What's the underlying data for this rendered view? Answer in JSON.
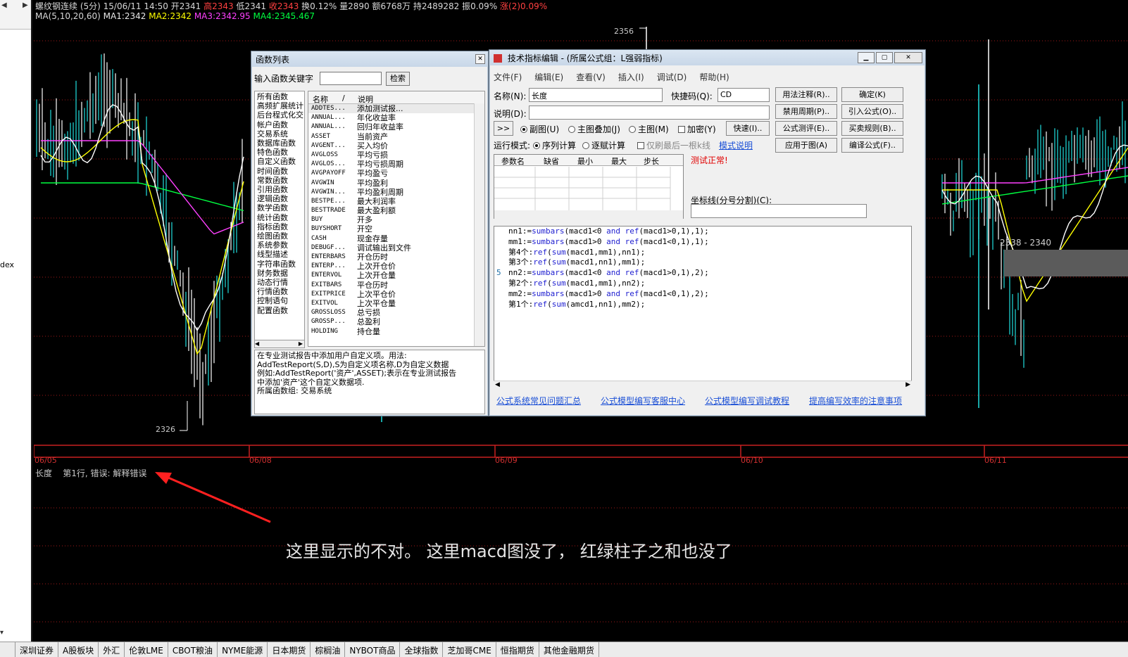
{
  "chart_header": {
    "line1": [
      {
        "text": "螺纹钢连续 (5分) 15/06/11 14:50",
        "color": "#d8d8d8"
      },
      {
        "text": "开2341",
        "color": "#d8d8d8"
      },
      {
        "text": "高2343",
        "color": "#ff4040"
      },
      {
        "text": "低2341",
        "color": "#d8d8d8"
      },
      {
        "text": "收2343",
        "color": "#ff4040"
      },
      {
        "text": "换0.12%",
        "color": "#d8d8d8"
      },
      {
        "text": "量2890",
        "color": "#d8d8d8"
      },
      {
        "text": "额6768万",
        "color": "#d8d8d8"
      },
      {
        "text": "持2489282",
        "color": "#d8d8d8"
      },
      {
        "text": "振0.09%",
        "color": "#d8d8d8"
      },
      {
        "text": "涨(2)0.09%",
        "color": "#ff4040"
      }
    ],
    "line2": [
      {
        "text": "MA(5,10,20,60)",
        "color": "#d8d8d8"
      },
      {
        "text": "MA1:2342",
        "color": "#e8e8e8"
      },
      {
        "text": "MA2:2342",
        "color": "#ffff00"
      },
      {
        "text": "MA3:2342.95",
        "color": "#ff40ff"
      },
      {
        "text": "MA4:2345.467",
        "color": "#00ff40"
      }
    ]
  },
  "price_labels": {
    "top_price": "2356",
    "bottom_price": "2326",
    "band": "2338 - 2340"
  },
  "dates": [
    "06/05",
    "06/08",
    "06/09",
    "06/10",
    "06/11"
  ],
  "sub_panel": {
    "indicator": "长度",
    "error": "第1行, 错误: 解释错误"
  },
  "annotation_text": "这里显示的不对。 这里macd图没了， 红绿柱子之和也没了",
  "left_panel": {
    "text": "dex"
  },
  "tabs": [
    "深圳证券",
    "A股板块",
    "外汇",
    "伦敦LME",
    "CBOT粮油",
    "NYME能源",
    "日本期货",
    "棕榈油",
    "NYBOT商品",
    "全球指数",
    "芝加哥CME",
    "恒指期货",
    "其他金融期货"
  ],
  "function_window": {
    "title": "函数列表",
    "search_label": "输入函数关键字",
    "search_value": "",
    "search_button": "检索",
    "categories": [
      "所有函数",
      "高频扩展统计",
      "后台程式化交",
      "帐户函数",
      "交易系统",
      "数据库函数",
      "特色函数",
      "自定义函数",
      "时间函数",
      "常数函数",
      "引用函数",
      "逻辑函数",
      "数学函数",
      "统计函数",
      "指标函数",
      "绘图函数",
      "系统参数",
      "线型描述",
      "字符串函数",
      "财务数据",
      "动态行情",
      "行情函数",
      "控制语句",
      "配置函数"
    ],
    "columns": [
      "名称",
      "/",
      "说明"
    ],
    "functions": [
      {
        "name": "ADDTES...",
        "desc": "添加测试报..."
      },
      {
        "name": "ANNUAL...",
        "desc": "年化收益率"
      },
      {
        "name": "ANNUAL...",
        "desc": "回归年收益率"
      },
      {
        "name": "ASSET",
        "desc": "当前资产"
      },
      {
        "name": "AVGENT...",
        "desc": "买入均价"
      },
      {
        "name": "AVGLOSS",
        "desc": "平均亏损"
      },
      {
        "name": "AVGLOS...",
        "desc": "平均亏损周期"
      },
      {
        "name": "AVGPAYOFF",
        "desc": "平均盈亏"
      },
      {
        "name": "AVGWIN",
        "desc": "平均盈利"
      },
      {
        "name": "AVGWIN...",
        "desc": "平均盈利周期"
      },
      {
        "name": "BESTPE...",
        "desc": "最大利润率"
      },
      {
        "name": "BESTTRADE",
        "desc": "最大盈利额"
      },
      {
        "name": "BUY",
        "desc": "开多"
      },
      {
        "name": "BUYSHORT",
        "desc": "开空"
      },
      {
        "name": "CASH",
        "desc": "现金存量"
      },
      {
        "name": "DEBUGF...",
        "desc": "调试输出到文件"
      },
      {
        "name": "ENTERBARS",
        "desc": "开仓历时"
      },
      {
        "name": "ENTERP...",
        "desc": "上次开仓价"
      },
      {
        "name": "ENTERVOL",
        "desc": "上次开仓量"
      },
      {
        "name": "EXITBARS",
        "desc": "平仓历时"
      },
      {
        "name": "EXITPRICE",
        "desc": "上次平仓价"
      },
      {
        "name": "EXITVOL",
        "desc": "上次平仓量"
      },
      {
        "name": "GROSSLOSS",
        "desc": "总亏损"
      },
      {
        "name": "GROSSP...",
        "desc": "总盈利"
      },
      {
        "name": "HOLDING",
        "desc": "持仓量"
      }
    ],
    "description_lines": [
      "在专业测试报告中添加用户自定义项。用法:",
      "AddTestReport(S,D),S为自定义项名称,D为自定义数据",
      "例如:AddTestReport('资产',ASSET);表示在专业测试报告",
      "中添加'资产'这个自定义数据项.",
      "所属函数组: 交易系统"
    ]
  },
  "editor_window": {
    "title": "技术指标编辑 - (所属公式组：L强弱指标)",
    "menu": [
      "文件(F)",
      "编辑(E)",
      "查看(V)",
      "插入(I)",
      "调试(D)",
      "帮助(H)"
    ],
    "name_label": "名称(N):",
    "name_value": "长度",
    "shortcut_label": "快捷码(Q):",
    "shortcut_value": "CD",
    "desc_label": "说明(D):",
    "desc_value": "",
    "buttons_right": [
      "用法注释(R)..",
      "确定(K)",
      "禁用周期(P)..",
      "引入公式(O)..",
      "公式测评(E)..",
      "买卖规则(B)..",
      "应用于图(A)",
      "编译公式(F).."
    ],
    "expand_button": ">>",
    "chart_options": [
      {
        "label": "副图(U)",
        "checked": true
      },
      {
        "label": "主图叠加(J)",
        "checked": false
      },
      {
        "label": "主图(M)",
        "checked": false
      }
    ],
    "encrypt_label": "加密(Y)",
    "fast_button": "快速(I)..",
    "run_mode_label": "运行模式:",
    "run_modes": [
      {
        "label": "序列计算",
        "checked": true
      },
      {
        "label": "逐赋计算",
        "checked": false
      }
    ],
    "last_k_label": "仅刷最后一根k线",
    "mode_link": "模式说明",
    "param_columns": [
      "参数名",
      "缺省",
      "最小",
      "最大",
      "步长"
    ],
    "status": "测试正常!",
    "axis_label": "坐标线(分号分割)(C):",
    "axis_value": "",
    "code_lines": [
      "nn1:=sumbars(macd1<0 and ref(macd1>0,1),1);",
      "mm1:=sumbars(macd1>0 and ref(macd1<0,1),1);",
      "第4个:ref(sum(macd1,mm1),nn1);",
      "第3个:ref(sum(macd1,nn1),mm1);",
      "nn2:=sumbars(macd1<0 and ref(macd1>0,1),2);",
      "第2个:ref(sum(macd1,mm1),nn2);",
      "mm2:=sumbars(macd1>0 and ref(macd1<0,1),2);",
      "第1个:ref(sum(amcd1,nn1),mm2);"
    ],
    "marker_line_number": "5",
    "links": [
      "公式系统常见问题汇总",
      "公式模型编写客服中心",
      "公式模型编写调试教程",
      "提高编写效率的注意事项"
    ]
  },
  "colors": {
    "background": "#000000",
    "grid_red": "#c82020",
    "candle_up": "#ffffff",
    "candle_down": "#20e0e0",
    "ma1": "#ffffff",
    "ma2": "#ffff00",
    "ma3": "#ff40ff",
    "ma4": "#00ff40",
    "arrow": "#ff2020"
  }
}
